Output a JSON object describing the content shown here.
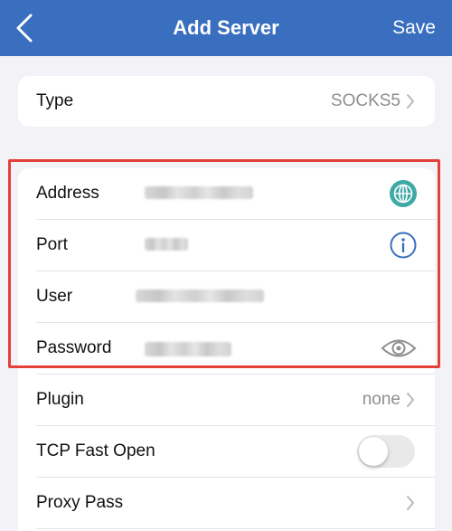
{
  "nav": {
    "title": "Add Server",
    "save_label": "Save",
    "bar_color": "#3a6fbf"
  },
  "type_row": {
    "label": "Type",
    "value": "SOCKS5"
  },
  "connection": {
    "highlight_color": "#e3413a",
    "address": {
      "label": "Address",
      "icon": "globe-icon"
    },
    "port": {
      "label": "Port",
      "icon": "info-icon"
    },
    "user": {
      "label": "User"
    },
    "password": {
      "label": "Password",
      "icon": "eye-icon"
    }
  },
  "options": {
    "plugin": {
      "label": "Plugin",
      "value": "none"
    },
    "tcp_fast_open": {
      "label": "TCP Fast Open",
      "enabled": false
    },
    "proxy_pass": {
      "label": "Proxy Pass"
    }
  }
}
